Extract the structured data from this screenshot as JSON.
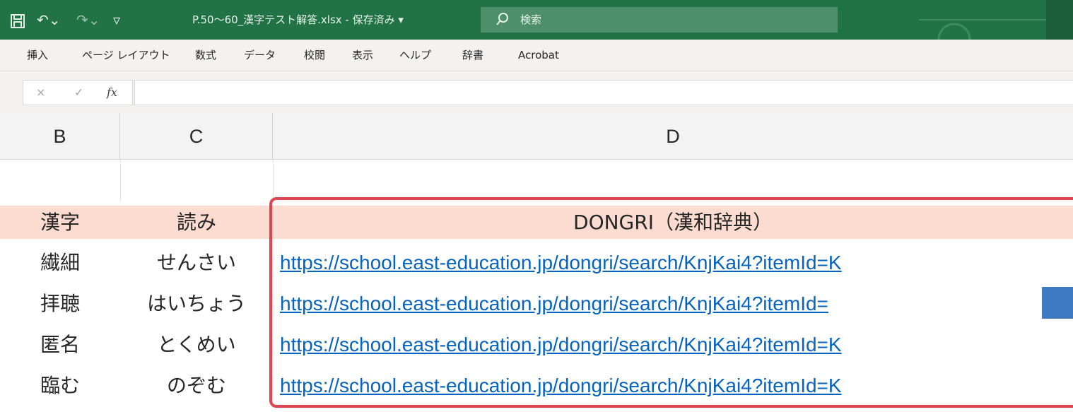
{
  "titlebar": {
    "file_name": "P.50～60_漢字テスト解答.xlsx - 保存済み ▾",
    "search_placeholder": "検索",
    "save_glyph": "⍰",
    "undo_glyph": "↶⌄",
    "redo_glyph": "↷⌄",
    "customize_glyph": "▿"
  },
  "ribbon": {
    "tabs": [
      "挿入",
      "ページ レイアウト",
      "数式",
      "データ",
      "校閲",
      "表示",
      "ヘルプ",
      "辞書",
      "Acrobat"
    ]
  },
  "formula_bar": {
    "cancel": "×",
    "enter": "✓",
    "fx": "fx",
    "value": ""
  },
  "columns": [
    "B",
    "C",
    "D"
  ],
  "table": {
    "header": {
      "b": "漢字",
      "c": "読み",
      "d": "DONGRI（漢和辞典）"
    },
    "rows": [
      {
        "kanji": "繊細",
        "yomi": "せんさい",
        "url": "https://school.east-education.jp/dongri/search/KnjKai4?itemId=K"
      },
      {
        "kanji": "拝聴",
        "yomi": "はいちょう",
        "url": "https://school.east-education.jp/dongri/search/KnjKai4?itemId="
      },
      {
        "kanji": "匿名",
        "yomi": "とくめい",
        "url": "https://school.east-education.jp/dongri/search/KnjKai4?itemId=K"
      },
      {
        "kanji": "臨む",
        "yomi": "のぞむ",
        "url": "https://school.east-education.jp/dongri/search/KnjKai4?itemId=K"
      }
    ]
  },
  "colors": {
    "titlebar": "#217346",
    "header_row": "#fcdcd0",
    "link": "#0563c1",
    "highlight_border": "#e0444f",
    "selection": "#3f79c1"
  }
}
